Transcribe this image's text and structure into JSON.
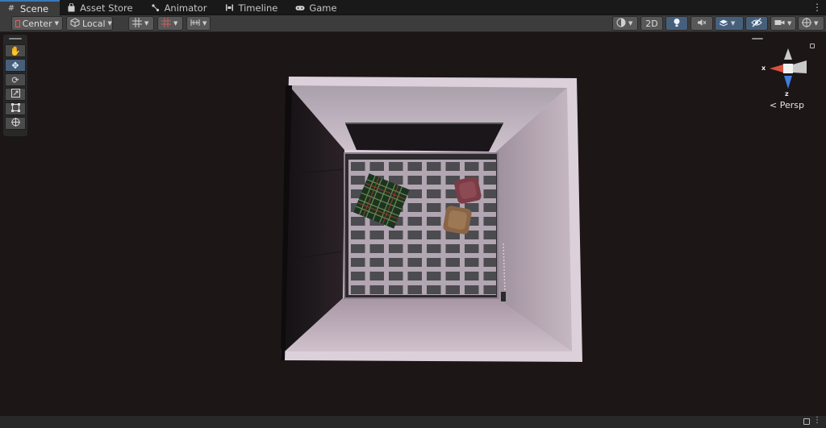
{
  "tabs": [
    {
      "label": "Scene",
      "icon": "hash-grid-icon",
      "active": true
    },
    {
      "label": "Asset Store",
      "icon": "shopping-bag-icon",
      "active": false
    },
    {
      "label": "Animator",
      "icon": "animator-icon",
      "active": false
    },
    {
      "label": "Timeline",
      "icon": "timeline-icon",
      "active": false
    },
    {
      "label": "Game",
      "icon": "gamepad-icon",
      "active": false
    }
  ],
  "toolbar": {
    "pivot_label": "Center",
    "space_label": "Local",
    "mode_2d_label": "2D"
  },
  "gizmo": {
    "projection_label": "Persp",
    "axis_x": "x",
    "axis_z": "z",
    "colors": {
      "x": "#d8523f",
      "y": "#c9c9c9",
      "z": "#3f7ede"
    }
  },
  "colors": {
    "accent": "#3a79bb",
    "active_button": "#46607c",
    "scene_background": "#1c1617",
    "room_wall": "#a99aa6"
  }
}
